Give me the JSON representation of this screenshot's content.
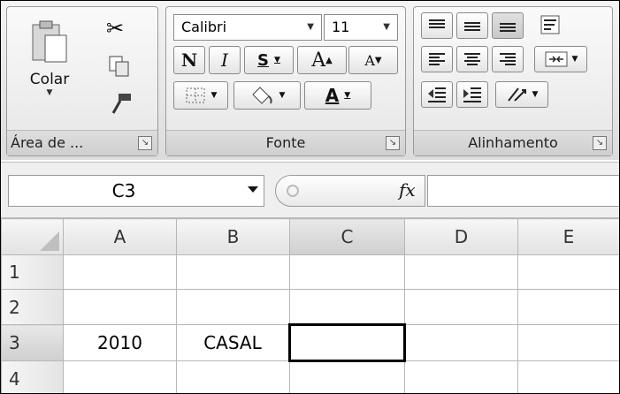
{
  "ribbon": {
    "clipboard": {
      "paste_label": "Colar",
      "group_label": "Área de ...",
      "icons": [
        "paste-icon",
        "cut-icon",
        "copy-icon",
        "format-painter-icon"
      ]
    },
    "font": {
      "font_name": "Calibri",
      "font_size": "11",
      "bold": "N",
      "italic": "I",
      "underline": "S",
      "grow": "A",
      "shrink": "A",
      "font_color": "A",
      "group_label": "Fonte"
    },
    "alignment": {
      "group_label": "Alinhamento"
    }
  },
  "formula_bar": {
    "name_box": "C3",
    "fx": "fx",
    "formula": ""
  },
  "sheet": {
    "columns": [
      "A",
      "B",
      "C",
      "D",
      "E"
    ],
    "rows": [
      {
        "num": "1",
        "cells": [
          "",
          "",
          "",
          "",
          ""
        ]
      },
      {
        "num": "2",
        "cells": [
          "",
          "",
          "",
          "",
          ""
        ]
      },
      {
        "num": "3",
        "cells": [
          "2010",
          "CASAL",
          "",
          "",
          ""
        ]
      },
      {
        "num": "4",
        "cells": [
          "",
          "",
          "",
          "",
          ""
        ]
      }
    ],
    "active_cell": "C3"
  }
}
